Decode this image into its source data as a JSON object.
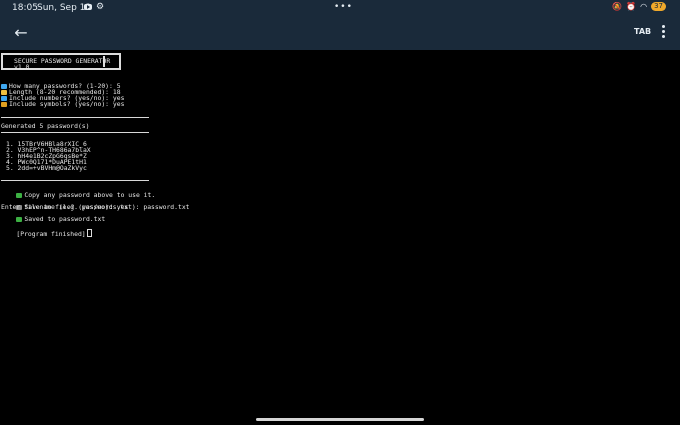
{
  "status_bar": {
    "time": "18:05",
    "date": "Sun, Sep 13",
    "battery": "37",
    "center_dots": "•••"
  },
  "toolbar": {
    "tab_label": "TAB",
    "background_color": "#1a2a3a"
  },
  "terminal": {
    "banner_title": "SECURE PASSWORD GENERATOR",
    "banner_version": "v1.0",
    "prompts": [
      {
        "icon": "keypad-icon",
        "color": "#3fa8f0",
        "text": "How many passwords? (1-20): 5"
      },
      {
        "icon": "ruler-icon",
        "color": "#f0c040",
        "text": "Length (8-20 recommended): 18"
      },
      {
        "icon": "numbers-icon",
        "color": "#3fa8f0",
        "text": "Include numbers? (yes/no): yes"
      },
      {
        "icon": "symbols-icon",
        "color": "#e0a020",
        "text": "Include symbols? (yes/no): yes"
      }
    ],
    "generated_line": "Generated 5 password(s)",
    "passwords": [
      "1. 15TBrV6HBla8rXIC_6",
      "2. V3hEP^n-TH686a7blaX",
      "3. hH4e1B2cZpG6qsBe*Z",
      "4. PWc0Q171*DuAPE1tH1",
      "5. 2dd=+vBVHm@OaZkVyc"
    ],
    "copy_note": "Copy any password above to use it.",
    "save_prompt": "Save to file? (yes/no): yes",
    "filename_prompt": "Enter filename (e.g. passwords.txt): password.txt",
    "saved_line": "Saved to password.txt",
    "finished_line": "[Program finished]",
    "check_color": "#3cb043",
    "floppy_color": "#8a8a8a"
  }
}
